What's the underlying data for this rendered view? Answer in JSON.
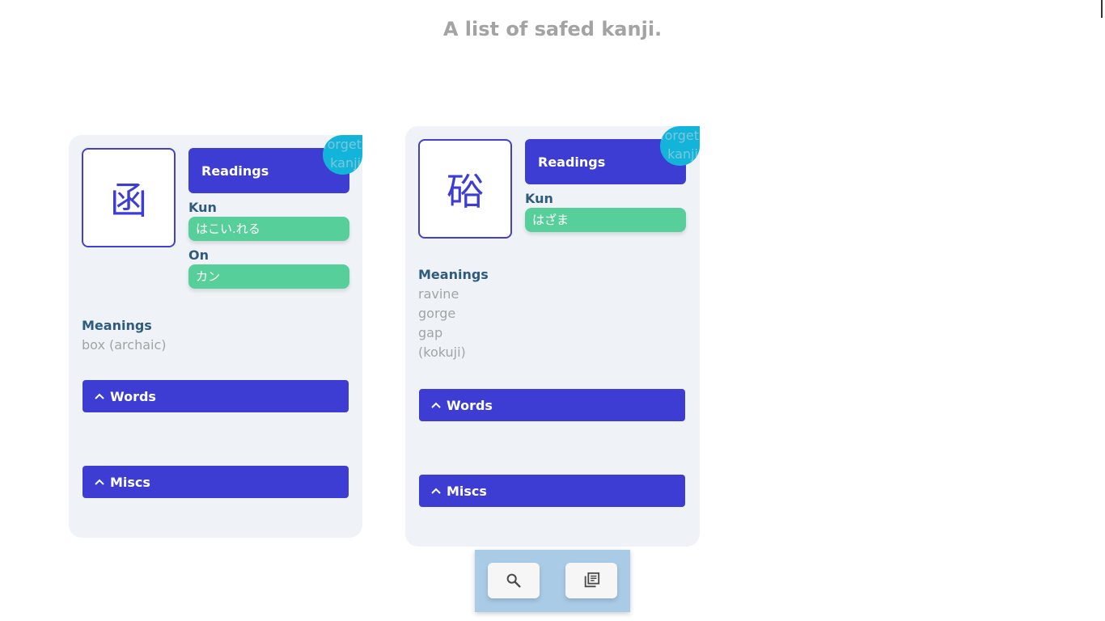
{
  "page": {
    "title": "A list of safed kanji."
  },
  "cards": [
    {
      "kanji": "函",
      "forget": [
        "forget",
        "kanji"
      ],
      "readings_label": "Readings",
      "kun_label": "Kun",
      "kun": [
        "はこい.れる"
      ],
      "on_label": "On",
      "on": [
        "カン"
      ],
      "meanings_label": "Meanings",
      "meanings": [
        "box (archaic)"
      ],
      "words_label": "Words",
      "miscs_label": "Miscs"
    },
    {
      "kanji": "硲",
      "forget": [
        "forget",
        "kanji"
      ],
      "readings_label": "Readings",
      "kun_label": "Kun",
      "kun": [
        "はざま"
      ],
      "meanings_label": "Meanings",
      "meanings": [
        "ravine",
        "gorge",
        "gap",
        "(kokuji)"
      ],
      "words_label": "Words",
      "miscs_label": "Miscs"
    }
  ],
  "toolbar": {
    "search_icon": "search-icon",
    "library_icon": "library-books-icon"
  },
  "colors": {
    "accent": "#3d3dd4",
    "reading_chip": "#57cf9b",
    "forget_bubble": "#12b5d9",
    "card_bg": "#eff3f8",
    "label": "#2f5b7c",
    "muted": "#a3a3a3",
    "toolbar_bg": "#a9cbe6"
  }
}
